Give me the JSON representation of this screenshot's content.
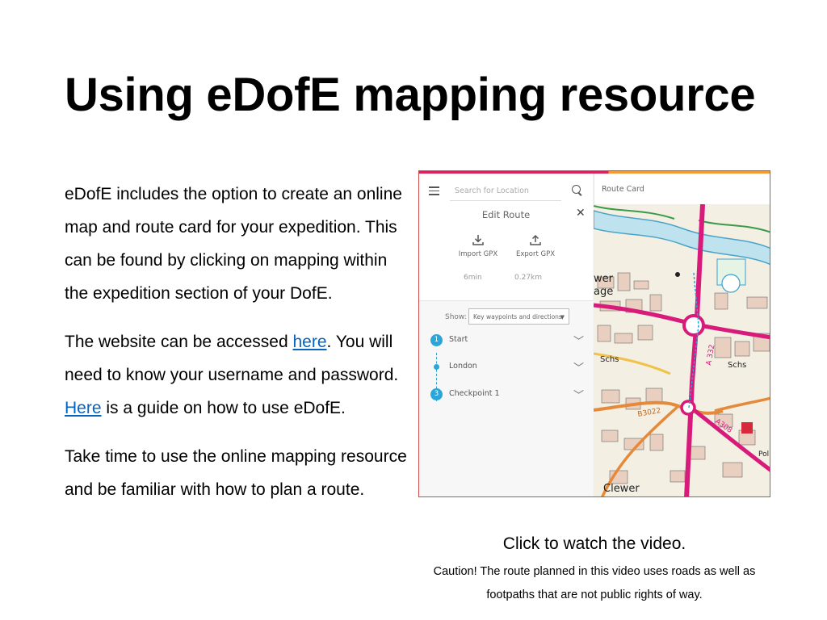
{
  "title": "Using eDofE mapping resource",
  "paragraphs": {
    "p1": "eDofE includes the option to create an online map and route card for your expedition.  This can be found by clicking on mapping within the expedition section of your DofE.",
    "p2_a": "The website can be accessed ",
    "p2_link1": "here",
    "p2_b": ".  You will need to know your username and password.  ",
    "p2_link2": "Here",
    "p2_c": " is a guide on how to use eDofE.",
    "p3": "Take time to use the online mapping resource and be familiar with how to plan a route."
  },
  "screenshot": {
    "search_placeholder": "Search for Location",
    "route_card_label": "Route Card",
    "edit_route": "Edit Route",
    "close_glyph": "✕",
    "import_label": "Import GPX",
    "export_label": "Export GPX",
    "import_icon": "download-icon",
    "export_icon": "upload-icon",
    "duration": "6min",
    "distance": "0.27km",
    "show_label": "Show:",
    "show_value": "Key waypoints and directions",
    "waypoints": [
      {
        "number": "1",
        "label": "Start"
      },
      {
        "number": "",
        "label": "London"
      },
      {
        "number": "3",
        "label": "Checkpoint 1"
      }
    ],
    "map_labels": {
      "road1": "A 332",
      "road2": "A308",
      "road3": "B3022",
      "schs1": "Schs",
      "schs2": "Schs",
      "clewer": "Clewer",
      "wer": "wer",
      "age": "age",
      "pol": "Pol"
    },
    "colors": {
      "accent_pink": "#d8245a",
      "accent_orange": "#f39b34",
      "waypoint_blue": "#2aa6d9",
      "road_magenta": "#d81b7a"
    }
  },
  "caption": {
    "main": "Click to watch the video.",
    "caution": "Caution!  The route planned in this video uses roads as well as footpaths that are not public rights of way."
  }
}
